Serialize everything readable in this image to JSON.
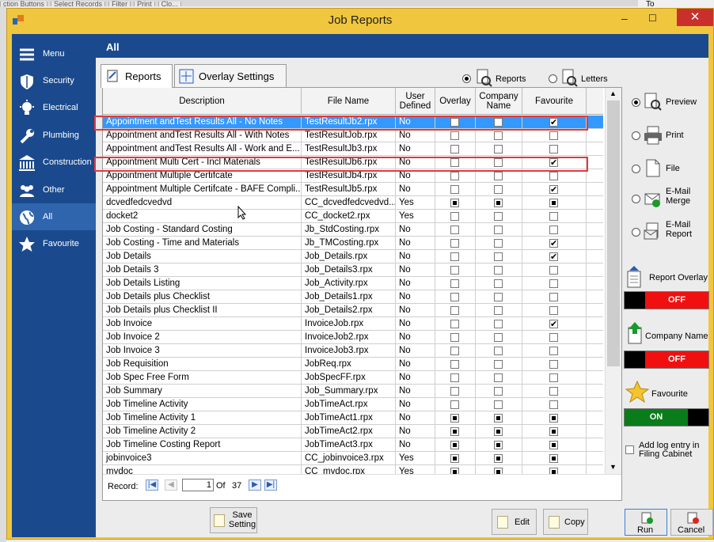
{
  "background": {
    "top_strip": [
      "ction Buttons",
      "Select Records",
      "Filter",
      "Print",
      "Clo..."
    ],
    "right_label": "To"
  },
  "window": {
    "title": "Job Reports",
    "close_glyph": "✕",
    "minimize_glyph": "–",
    "maximize_glyph": "☐"
  },
  "sidebar": {
    "items": [
      {
        "label": "Menu",
        "icon": "hamburger-icon"
      },
      {
        "label": "Security",
        "icon": "shield-icon"
      },
      {
        "label": "Electrical",
        "icon": "lightbulb-icon"
      },
      {
        "label": "Plumbing",
        "icon": "wrench-icon"
      },
      {
        "label": "Construction",
        "icon": "building-icon"
      },
      {
        "label": "Other",
        "icon": "people-icon"
      },
      {
        "label": "All",
        "icon": "globe-icon",
        "active": true
      },
      {
        "label": "Favourite",
        "icon": "star-icon"
      }
    ]
  },
  "header": {
    "title": "All"
  },
  "tabs": [
    {
      "label": "Reports",
      "active": true
    },
    {
      "label": "Overlay Settings",
      "active": false
    }
  ],
  "mode": {
    "reports_label": "Reports",
    "letters_label": "Letters",
    "selected": "Reports"
  },
  "grid": {
    "columns": [
      "Description",
      "File Name",
      "User Defined",
      "Overlay",
      "Company Name",
      "Favourite"
    ],
    "rows": [
      {
        "description": "Appointment andTest Results All - No Notes",
        "file": "TestResultJb2.rpx",
        "user": "No",
        "overlay": "empty",
        "company": "empty",
        "fav": "checked",
        "selected": true
      },
      {
        "description": "Appointment andTest Results All - With Notes",
        "file": "TestResultJob.rpx",
        "user": "No",
        "overlay": "empty",
        "company": "empty",
        "fav": "empty"
      },
      {
        "description": "Appointment andTest Results All - Work and E...",
        "file": "TestResultJb3.rpx",
        "user": "No",
        "overlay": "empty",
        "company": "empty",
        "fav": "empty"
      },
      {
        "description": "Appointment Multi Cert - Incl Materials",
        "file": "TestResultJb6.rpx",
        "user": "No",
        "overlay": "empty",
        "company": "empty",
        "fav": "checked"
      },
      {
        "description": "Appointment Multiple Certifcate",
        "file": "TestResultJb4.rpx",
        "user": "No",
        "overlay": "empty",
        "company": "empty",
        "fav": "empty"
      },
      {
        "description": "Appointment Multiple Certifcate - BAFE Compli...",
        "file": "TestResultJb5.rpx",
        "user": "No",
        "overlay": "empty",
        "company": "empty",
        "fav": "checked"
      },
      {
        "description": "dcvedfedcvedvd",
        "file": "CC_dcvedfedcvedvd...",
        "user": "Yes",
        "overlay": "indeterminate",
        "company": "indeterminate",
        "fav": "indeterminate"
      },
      {
        "description": "docket2",
        "file": "CC_docket2.rpx",
        "user": "Yes",
        "overlay": "empty",
        "company": "empty",
        "fav": "empty"
      },
      {
        "description": "Job Costing - Standard Costing",
        "file": "Jb_StdCosting.rpx",
        "user": "No",
        "overlay": "empty",
        "company": "empty",
        "fav": "empty"
      },
      {
        "description": "Job Costing - Time and Materials",
        "file": "Jb_TMCosting.rpx",
        "user": "No",
        "overlay": "empty",
        "company": "empty",
        "fav": "checked"
      },
      {
        "description": "Job Details",
        "file": "Job_Details.rpx",
        "user": "No",
        "overlay": "empty",
        "company": "empty",
        "fav": "checked"
      },
      {
        "description": "Job Details 3",
        "file": "Job_Details3.rpx",
        "user": "No",
        "overlay": "empty",
        "company": "empty",
        "fav": "empty"
      },
      {
        "description": "Job Details Listing",
        "file": "Job_Activity.rpx",
        "user": "No",
        "overlay": "empty",
        "company": "empty",
        "fav": "empty"
      },
      {
        "description": "Job Details plus Checklist",
        "file": "Job_Details1.rpx",
        "user": "No",
        "overlay": "empty",
        "company": "empty",
        "fav": "empty"
      },
      {
        "description": "Job Details plus Checklist II",
        "file": "Job_Details2.rpx",
        "user": "No",
        "overlay": "empty",
        "company": "empty",
        "fav": "empty"
      },
      {
        "description": "Job Invoice",
        "file": "InvoiceJob.rpx",
        "user": "No",
        "overlay": "empty",
        "company": "empty",
        "fav": "checked"
      },
      {
        "description": "Job Invoice 2",
        "file": "InvoiceJob2.rpx",
        "user": "No",
        "overlay": "empty",
        "company": "empty",
        "fav": "empty"
      },
      {
        "description": "Job Invoice 3",
        "file": "InvoiceJob3.rpx",
        "user": "No",
        "overlay": "empty",
        "company": "empty",
        "fav": "empty"
      },
      {
        "description": "Job Requisition",
        "file": "JobReq.rpx",
        "user": "No",
        "overlay": "empty",
        "company": "empty",
        "fav": "empty"
      },
      {
        "description": "Job Spec Free Form",
        "file": "JobSpecFF.rpx",
        "user": "No",
        "overlay": "empty",
        "company": "empty",
        "fav": "empty"
      },
      {
        "description": "Job Summary",
        "file": "Job_Summary.rpx",
        "user": "No",
        "overlay": "empty",
        "company": "empty",
        "fav": "empty"
      },
      {
        "description": "Job Timeline Activity",
        "file": "JobTimeAct.rpx",
        "user": "No",
        "overlay": "empty",
        "company": "empty",
        "fav": "empty"
      },
      {
        "description": "Job Timeline Activity 1",
        "file": "JobTimeAct1.rpx",
        "user": "No",
        "overlay": "indeterminate",
        "company": "indeterminate",
        "fav": "indeterminate"
      },
      {
        "description": "Job Timeline Activity 2",
        "file": "JobTimeAct2.rpx",
        "user": "No",
        "overlay": "indeterminate",
        "company": "indeterminate",
        "fav": "indeterminate"
      },
      {
        "description": "Job Timeline Costing Report",
        "file": "JobTimeAct3.rpx",
        "user": "No",
        "overlay": "indeterminate",
        "company": "indeterminate",
        "fav": "indeterminate"
      },
      {
        "description": "jobinvoice3",
        "file": "CC_jobinvoice3.rpx",
        "user": "Yes",
        "overlay": "indeterminate",
        "company": "indeterminate",
        "fav": "indeterminate"
      },
      {
        "description": "mydoc",
        "file": "CC_mydoc.rpx",
        "user": "Yes",
        "overlay": "indeterminate",
        "company": "indeterminate",
        "fav": "indeterminate"
      }
    ]
  },
  "navigator": {
    "label": "Record:",
    "current": "1",
    "of_label": "Of",
    "total": "37"
  },
  "output": {
    "options": [
      {
        "label": "Preview",
        "icon": "preview-icon",
        "selected": true
      },
      {
        "label": "Print",
        "icon": "printer-icon",
        "selected": false
      },
      {
        "label": "File",
        "icon": "file-icon",
        "selected": false
      },
      {
        "label": "E-Mail Merge",
        "icon": "email-merge-icon",
        "selected": false
      },
      {
        "label": "E-Mail Report",
        "icon": "email-report-icon",
        "selected": false
      }
    ]
  },
  "toggles": {
    "report_overlay": {
      "label": "Report Overlay",
      "value": "OFF",
      "color": "#f01010"
    },
    "company_name": {
      "label": "Company Name",
      "value": "OFF",
      "color": "#f01010"
    },
    "favourite": {
      "label": "Favourite",
      "value": "ON",
      "color": "#0a7d1a"
    }
  },
  "log_entry": {
    "label": "Add log entry in Filing Cabinet",
    "checked": false
  },
  "buttons": {
    "save_setting": "Save Setting",
    "edit": "Edit",
    "copy": "Copy",
    "run": "Run",
    "cancel": "Cancel"
  },
  "colors": {
    "sidebar": "#1a4a8d",
    "titlebar": "#f0c63e",
    "selection": "#3399ff",
    "highlight_box": "#e0393e"
  }
}
